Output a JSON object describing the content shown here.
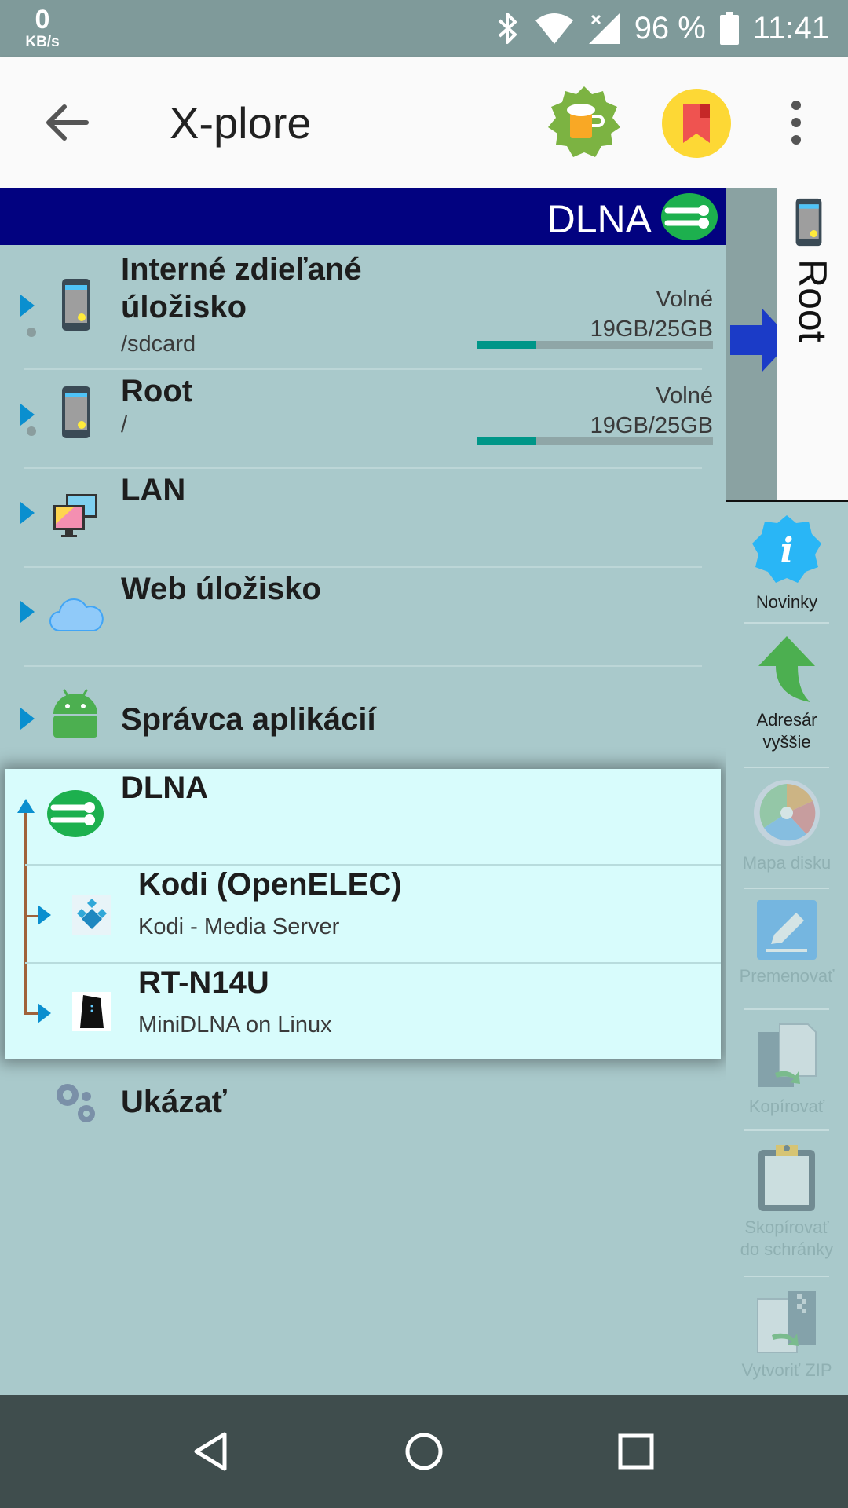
{
  "status_bar": {
    "net_speed": "0",
    "net_unit": "KB/s",
    "battery": "96 %",
    "time": "11:41"
  },
  "app_bar": {
    "title": "X-plore"
  },
  "left_pane": {
    "header_label": "DLNA",
    "rows": [
      {
        "title_line1": "Interné zdieľané",
        "title_line2": "úložisko",
        "path": "/sdcard",
        "free_label": "Volné",
        "free_value": "19GB/25GB",
        "usage_fraction": 0.24
      },
      {
        "title": "Root",
        "path": "/",
        "free_label": "Volné",
        "free_value": "19GB/25GB",
        "usage_fraction": 0.24
      },
      {
        "title": "LAN"
      },
      {
        "title": "Web úložisko"
      },
      {
        "title": "Správca aplikácií"
      }
    ],
    "dlna": {
      "title": "DLNA",
      "servers": [
        {
          "name": "Kodi (OpenELEC)",
          "desc": "Kodi - Media Server"
        },
        {
          "name": "RT-N14U",
          "desc": "MiniDLNA on Linux"
        }
      ]
    },
    "show_label": "Ukázať"
  },
  "right_pane": {
    "tab_label": "Root",
    "tools": [
      {
        "label": "Novinky",
        "enabled": true
      },
      {
        "label": "Adresár vyššie",
        "enabled": true
      },
      {
        "label": "Mapa disku",
        "enabled": false
      },
      {
        "label": "Premenovať",
        "enabled": false
      },
      {
        "label": "Kopírovať",
        "enabled": false
      },
      {
        "label": "Skopírovať do schránky",
        "enabled": false
      },
      {
        "label": "Vytvoriť ZIP",
        "enabled": false
      }
    ]
  },
  "colors": {
    "pane_bg": "#a9c9cb",
    "header_bg": "#020280",
    "accent_blue": "#0a8fcf",
    "storage_fill": "#009688",
    "dlna_panel_bg": "#d8fcfc",
    "nav_bg": "#3f4d4d"
  }
}
